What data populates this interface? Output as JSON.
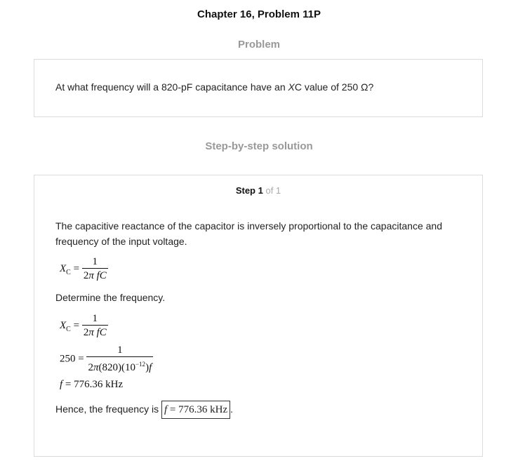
{
  "header": {
    "title": "Chapter 16, Problem 11P"
  },
  "problem": {
    "heading": "Problem",
    "text_before": "At what frequency will a 820-pF capacitance have an ",
    "xc_var": "X",
    "xc_rest": "C value of 250 Ω?"
  },
  "solution": {
    "heading": "Step-by-step solution",
    "step_label": "Step 1",
    "step_of": "of 1",
    "intro": "The capacitive reactance of the capacitor is inversely proportional to the capacitance and frequency of the input voltage.",
    "determine": "Determine the frequency.",
    "conclusion_prefix": "Hence, the frequency is",
    "conclusion_suffix": ".",
    "eq_var": "X",
    "eq_sub": "C",
    "eq_one": "1",
    "eq_den_2": "2",
    "eq_den_pi": "π",
    "eq_den_fc": "fC",
    "eq2_lhs": "250",
    "eq2_den": "(820)(10",
    "eq2_exp": "−12",
    "eq2_close": ")",
    "result_var": "f",
    "result_val": " = 776.36 kHz"
  }
}
